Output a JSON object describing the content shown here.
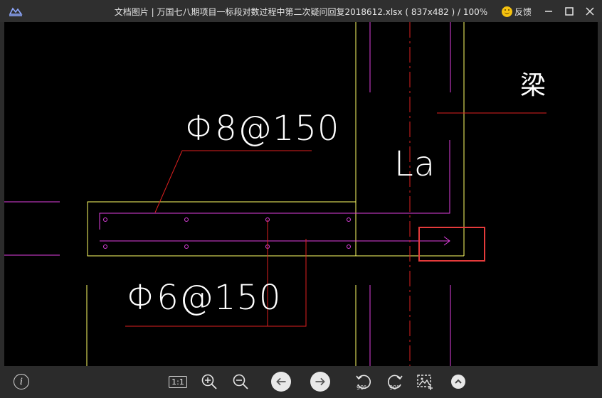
{
  "window": {
    "title": "文档图片 | 万国七八期项目一标段对数过程中第二次疑问回复2018612.xlsx ( 837x482 ) / 100%",
    "feedback_label": "反馈"
  },
  "drawing": {
    "label_phi8": "Φ8@150",
    "label_phi6": "Φ6@150",
    "label_la": "La",
    "label_liang": "梁"
  },
  "toolbar": {
    "actual_size_label": "1:1",
    "rotate_left_label": "90°",
    "rotate_right_label": "90°"
  },
  "colors": {
    "titlebar": "#2f2f2f",
    "toolbar": "#2b2b2b",
    "canvas": "#000000",
    "yellow_line": "#ffff66",
    "magenta_line": "#e040e0",
    "red_line": "#e02020",
    "highlight_box": "#e53b3b"
  }
}
